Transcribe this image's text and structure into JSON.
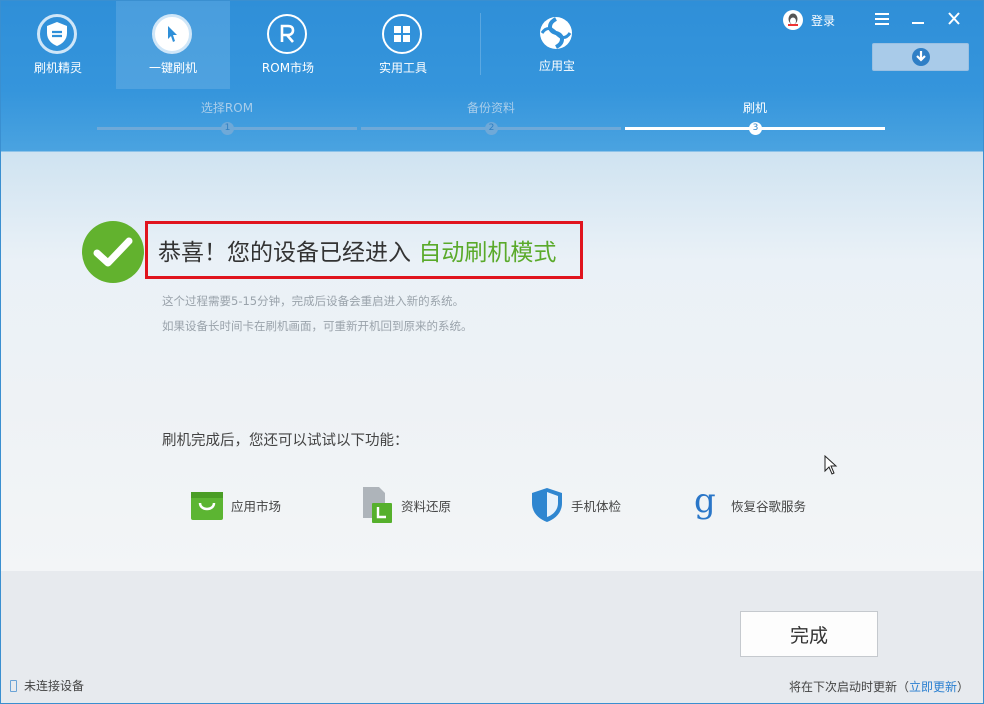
{
  "nav": {
    "items": [
      {
        "label": "刷机精灵",
        "icon": "shield-icon"
      },
      {
        "label": "一键刷机",
        "icon": "cursor-icon"
      },
      {
        "label": "ROM市场",
        "icon": "rom-r-icon"
      },
      {
        "label": "实用工具",
        "icon": "grid-icon"
      },
      {
        "label": "应用宝",
        "icon": "yingyongbao-logo-icon"
      }
    ],
    "active_index": 1
  },
  "header": {
    "login_label": "登录",
    "menu_icon": "hamburger-icon",
    "minimize_icon": "minimize-icon",
    "close_icon": "close-icon",
    "download_icon": "download-arrow-icon"
  },
  "steps": [
    {
      "label": "选择ROM",
      "number": "1"
    },
    {
      "label": "备份资料",
      "number": "2"
    },
    {
      "label": "刷机",
      "number": "3"
    }
  ],
  "main": {
    "headline_prefix": "恭喜！您的设备已经进入 ",
    "headline_highlight": "自动刷机模式",
    "desc_line1": "这个过程需要5-15分钟，完成后设备会重启进入新的系统。",
    "desc_line2": "如果设备长时间卡在刷机画面，可重新开机回到原来的系统。",
    "try_title": "刷机完成后，您还可以试试以下功能：",
    "features": [
      {
        "label": "应用市场",
        "icon": "shopping-bag-icon"
      },
      {
        "label": "资料还原",
        "icon": "document-restore-icon"
      },
      {
        "label": "手机体检",
        "icon": "shield-check-icon"
      },
      {
        "label": "恢复谷歌服务",
        "icon": "google-g-icon"
      }
    ]
  },
  "footer": {
    "done_label": "完成",
    "device_status": "未连接设备",
    "update_prefix": "将在下次启动时更新（",
    "update_link": "立即更新",
    "update_suffix": "）"
  },
  "colors": {
    "header_blue": "#2f8fd8",
    "success_green": "#62b22e",
    "highlight_green": "#5aaa2a",
    "annotation_red": "#e0141e",
    "link_blue": "#2a7fd0"
  }
}
